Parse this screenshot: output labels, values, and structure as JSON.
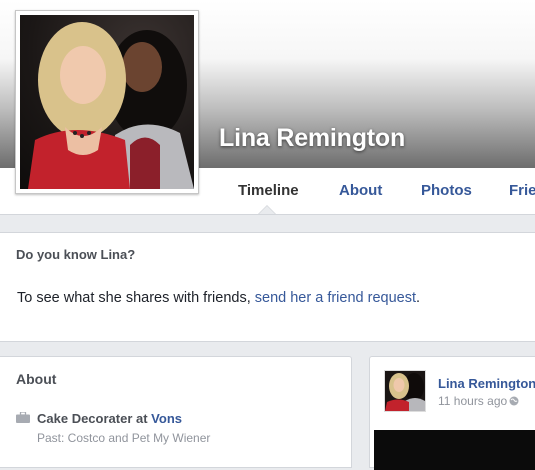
{
  "profile": {
    "name": "Lina Remington",
    "photo_icon": "profile-photo"
  },
  "tabs": [
    {
      "label": "Timeline",
      "active": true
    },
    {
      "label": "About",
      "active": false
    },
    {
      "label": "Photos",
      "active": false
    },
    {
      "label": "Frie",
      "active": false
    }
  ],
  "know": {
    "title": "Do you know Lina?",
    "text_prefix": "To see what she shares with friends, ",
    "link": "send her a friend request",
    "text_suffix": "."
  },
  "about": {
    "title": "About",
    "work_role": "Cake Decorater at ",
    "work_employer": "Vons",
    "work_past": "Past: Costco and Pet My Wiener",
    "work_icon": "briefcase-icon"
  },
  "post": {
    "author": "Lina Remington",
    "time": "11 hours ago",
    "privacy_icon": "globe-icon"
  },
  "colors": {
    "link": "#365899",
    "page_bg": "#e9ebee",
    "muted": "#90949c"
  }
}
